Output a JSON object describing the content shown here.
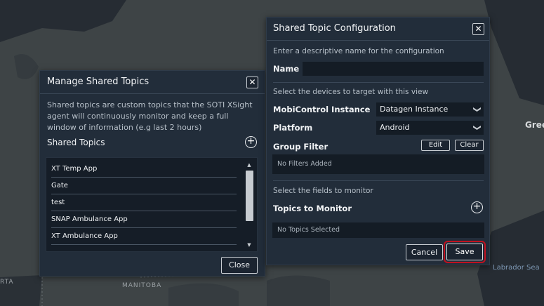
{
  "map": {
    "labels": {
      "gree": "Gree",
      "labrador_sea": "Labrador Sea",
      "manitoba": "MANITOBA",
      "rta": "RTA"
    }
  },
  "manage": {
    "title": "Manage Shared Topics",
    "close_icon": "✕",
    "description": "Shared topics are custom topics that the SOTI XSight agent will continuously monitor and keep a full window of information (e.g last 2 hours)",
    "shared_topics_label": "Shared Topics",
    "add_icon": "+",
    "topics": [
      "XT Temp App",
      "Gate",
      "test",
      "SNAP Ambulance App",
      "XT Ambulance App"
    ],
    "scroll_up": "▲",
    "scroll_down": "▼",
    "close_button": "Close"
  },
  "config": {
    "title": "Shared Topic Configuration",
    "close_icon": "✕",
    "name_hint": "Enter a descriptive name for the configuration",
    "name_label": "Name",
    "name_value": "",
    "devices_hint": "Select the devices to target with this view",
    "instance_label": "MobiControl Instance",
    "instance_value": "Datagen Instance",
    "platform_label": "Platform",
    "platform_value": "Android",
    "chevron": "❯",
    "group_filter_label": "Group Filter",
    "edit_button": "Edit",
    "clear_button": "Clear",
    "no_filters": "No Filters Added",
    "fields_hint": "Select the fields to monitor",
    "topics_label": "Topics to Monitor",
    "add_icon": "+",
    "no_topics": "No Topics Selected",
    "cancel_button": "Cancel",
    "save_button": "Save"
  }
}
